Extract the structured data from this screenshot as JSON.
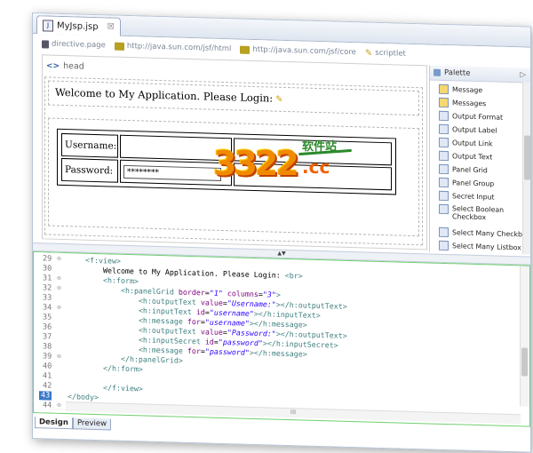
{
  "editor": {
    "tab_title": "MyJsp.jsp",
    "tab_close": "☒",
    "file_icon": "J"
  },
  "breadcrumb": [
    {
      "label": "directive.page",
      "icon": "directive-icon"
    },
    {
      "label": "http://java.sun.com/jsf/html",
      "icon": "taglib-icon"
    },
    {
      "label": "http://java.sun.com/jsf/core",
      "icon": "taglib-icon"
    },
    {
      "label": "scriptlet",
      "icon": "scriptlet-icon"
    }
  ],
  "design": {
    "head_tag": "<>",
    "head_label": "head",
    "welcome": "Welcome to My Application. Please Login:",
    "username_label": "Username:",
    "password_label": "Password:",
    "password_value": "********"
  },
  "palette": {
    "title": "Palette",
    "arrow": "▷",
    "items": [
      {
        "label": "Message"
      },
      {
        "label": "Messages"
      },
      {
        "label": "Output Format"
      },
      {
        "label": "Output Label"
      },
      {
        "label": "Output Link"
      },
      {
        "label": "Output Text"
      },
      {
        "label": "Panel Grid"
      },
      {
        "label": "Panel Group"
      },
      {
        "label": "Secret Input"
      },
      {
        "label": "Select Boolean Checkbox"
      },
      {
        "label": "Select Many Checkbox"
      },
      {
        "label": "Select Many Listbox"
      }
    ]
  },
  "source": {
    "line_numbers": [
      "29",
      "30",
      "31",
      "32",
      "33",
      "34",
      "35",
      "36",
      "37",
      "38",
      "39",
      "40",
      "41",
      "42",
      "43",
      "44"
    ],
    "selected_line": "43",
    "scroll_label": "III"
  },
  "bottom_tabs": [
    {
      "label": "Design",
      "active": true
    },
    {
      "label": "Preview",
      "active": false
    }
  ],
  "watermark": {
    "number": "3322",
    "cc": ".cc",
    "cn": "软件站"
  }
}
